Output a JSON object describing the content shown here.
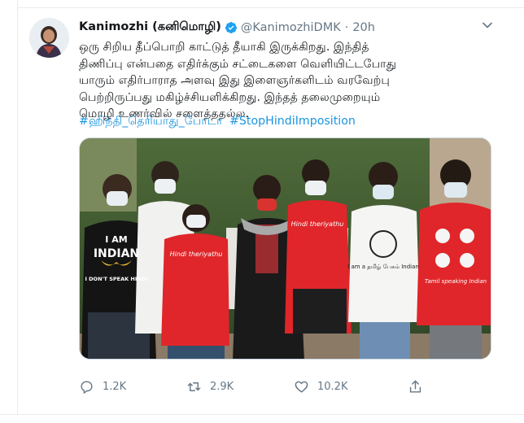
{
  "tweet": {
    "display_name": "Kanimozhi (கனிமொழி)",
    "handle": "@KanimozhiDMK",
    "separator": "·",
    "time": "20h",
    "verified_icon": "verified-badge-icon",
    "menu_icon": "chevron-down-icon",
    "text_lines": [
      "ஒரு சிறிய தீப்பொறி காட்டுத் தீயாகி இருக்கிறது.  இந்தித்",
      "திணிப்பு என்பதை எதிர்க்கும் சட்டைகளை வெளியிட்டபோது",
      "யாரும் எதிர்பாராத அளவு இது இளைஞர்களிடம் வரவேற்பு",
      "பெற்றிருப்பது மகிழ்ச்சியளிக்கிறது. இந்தத் தலைமுறையும்",
      "மொழி உணர்வில் சளைத்ததல்ல."
    ],
    "hashtags": [
      "#ஹிந்தி_தெரியாது_போடா",
      "#StopHindiImposition"
    ],
    "media": {
      "shirt_texts": [
        "I AM",
        "INDIAN",
        "I DON'T SPEAK HINDI",
        "Hindi theriyathu",
        "Hindi theriyathu",
        "I am a தமிழ் பேசும் Indian",
        "Tamil speaking Indian"
      ]
    }
  },
  "actions": {
    "reply": {
      "icon": "reply-icon",
      "count": "1.2K"
    },
    "retweet": {
      "icon": "retweet-icon",
      "count": "2.9K"
    },
    "like": {
      "icon": "heart-icon",
      "count": "10.2K"
    },
    "share": {
      "icon": "share-icon"
    }
  },
  "colors": {
    "link": "#1b95e0",
    "muted": "#657786",
    "verified": "#1da1f2",
    "border": "#e6ecf0"
  }
}
